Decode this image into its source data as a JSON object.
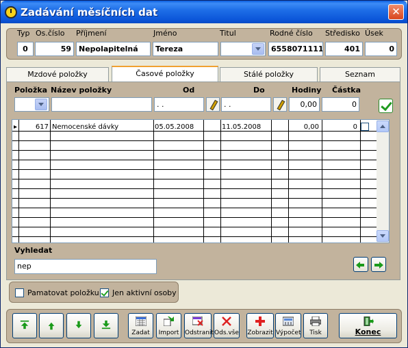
{
  "window": {
    "title": "Zadávání měsíčních dat",
    "close": "✕"
  },
  "header": {
    "labels": {
      "typ": "Typ",
      "os_cislo": "Os.číslo",
      "prijmeni": "Příjmení",
      "jmeno": "Jméno",
      "titul": "Titul",
      "rodne_cislo": "Rodné číslo",
      "stredisko": "Středisko",
      "usek": "Úsek"
    },
    "values": {
      "typ": "0",
      "os_cislo": "59",
      "prijmeni": "Nepolapitelná",
      "jmeno": "Tereza",
      "titul": "",
      "rodne_cislo": "6558071111",
      "stredisko": "401",
      "usek": "0"
    }
  },
  "tabs": [
    {
      "label": "Mzdové položky",
      "active": false
    },
    {
      "label": "Časové položky",
      "active": true
    },
    {
      "label": "Stálé položky",
      "active": false
    },
    {
      "label": "Seznam",
      "active": false
    }
  ],
  "entry": {
    "labels": {
      "polozka": "Položka",
      "nazev": "Název položky",
      "od": "Od",
      "do": "Do",
      "hodiny": "Hodiny",
      "castka": "Částka"
    },
    "values": {
      "polozka": "",
      "nazev": "",
      "od": " .  .",
      "do": " .  .",
      "hodiny": "0,00",
      "castka": "0"
    }
  },
  "table": {
    "rows": [
      {
        "polozka": "617",
        "nazev": "Nemocenské dávky",
        "od": "05.05.2008",
        "do": "11.05.2008",
        "hodiny": "0,00",
        "castka": "0"
      }
    ],
    "empty_rows": 12
  },
  "search": {
    "label": "Vyhledat",
    "value": "nep"
  },
  "options": {
    "pamatovat": "Pamatovat položku",
    "aktivni": "Jen aktivní osoby",
    "pamatovat_checked": false,
    "aktivni_checked": true
  },
  "toolbar": {
    "zadat": "Zadat",
    "import": "Import",
    "odstranit": "Odstranit",
    "ods_vse": "Ods.vše",
    "zobrazit": "Zobrazit",
    "vypocet": "Výpočet",
    "tisk": "Tisk",
    "konec": "Konec"
  },
  "colors": {
    "panel": "#c2b39d",
    "title_bar": "#0b55d8",
    "accent_green": "#1a9a1a"
  }
}
